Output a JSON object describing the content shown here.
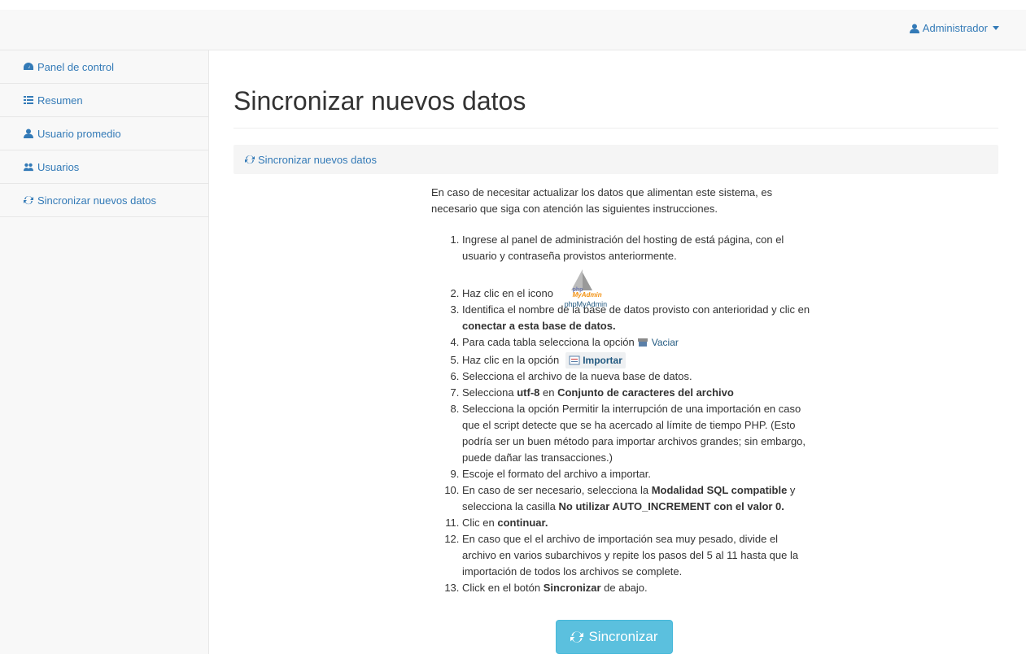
{
  "topbar": {
    "user_label": "Administrador"
  },
  "sidebar": {
    "items": [
      {
        "label": "Panel de control",
        "icon": "dashboard-icon"
      },
      {
        "label": "Resumen",
        "icon": "list-icon"
      },
      {
        "label": "Usuario promedio",
        "icon": "user-icon"
      },
      {
        "label": "Usuarios",
        "icon": "users-icon"
      },
      {
        "label": "Sincronizar nuevos datos",
        "icon": "refresh-icon"
      }
    ]
  },
  "main": {
    "title": "Sincronizar nuevos datos",
    "panel_heading": "Sincronizar nuevos datos",
    "intro": "En caso de necesitar actualizar los datos que alimentan este sistema, es necesario que siga con atención las siguientes instrucciones.",
    "steps": {
      "s1": "Ingrese al panel de administración del hosting de está página, con el usuario y contraseña provistos anteriormente.",
      "s2": "Haz clic en el icono",
      "s2_icon_caption": "phpMyAdmin",
      "s2_logo_a": "php",
      "s2_logo_b": "MyAdmin",
      "s3_a": "Identifica el nombre de la base de datos provisto con anterioridad y clic en ",
      "s3_b": "conectar a esta base de datos.",
      "s4": "Para cada tabla selecciona la opción",
      "s4_link": "Vaciar",
      "s5": "Haz clic en la opción",
      "s5_link": "Importar",
      "s6": "Selecciona el archivo de la nueva base de datos.",
      "s7_a": "Selecciona ",
      "s7_b": "utf-8",
      "s7_c": " en ",
      "s7_d": "Conjunto de caracteres del archivo",
      "s8": "Selecciona la opción Permitir la interrupción de una importación en caso que el script detecte que se ha acercado al límite de tiempo PHP. (Esto podría ser un buen método para importar archivos grandes; sin embargo, puede dañar las transacciones.)",
      "s9": "Escoje el formato del archivo a importar.",
      "s10_a": "En caso de ser necesario, selecciona la ",
      "s10_b": "Modalidad SQL compatible",
      "s10_c": " y selecciona la casilla ",
      "s10_d": "No utilizar AUTO_INCREMENT con el valor 0.",
      "s11_a": "Clic en ",
      "s11_b": "continuar.",
      "s12": "En caso que el el archivo de importación sea muy pesado, divide el archivo en varios subarchivos y repite los pasos del 5 al 11 hasta que la importación de todos los archivos se complete.",
      "s13_a": "Click en el botón ",
      "s13_b": "Sincronizar",
      "s13_c": " de abajo."
    },
    "button_label": "Sincronizar"
  },
  "colors": {
    "link": "#337ab7",
    "button": "#5bc0de",
    "sidebar_bg": "#f8f8f8"
  }
}
